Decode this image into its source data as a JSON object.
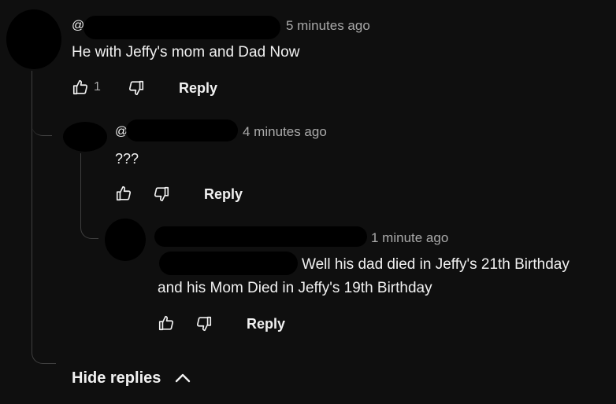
{
  "comments": [
    {
      "handle_initial": "@",
      "time": "5 minutes ago",
      "text": "He with Jeffy's mom and Dad Now",
      "likes": "1",
      "reply_label": "Reply"
    },
    {
      "handle_initial": "@",
      "time": "4 minutes ago",
      "text": "???",
      "reply_label": "Reply"
    },
    {
      "handle_initial": "@",
      "time": "1 minute ago",
      "text_line1": "Well his dad died in Jeffy's 21th Birthday",
      "text_line2": "and his Mom Died in Jeffy's 19th Birthday",
      "reply_label": "Reply"
    }
  ],
  "hide_replies_label": "Hide replies",
  "icons": [
    "like-icon",
    "dislike-icon",
    "chevron-up-icon"
  ]
}
